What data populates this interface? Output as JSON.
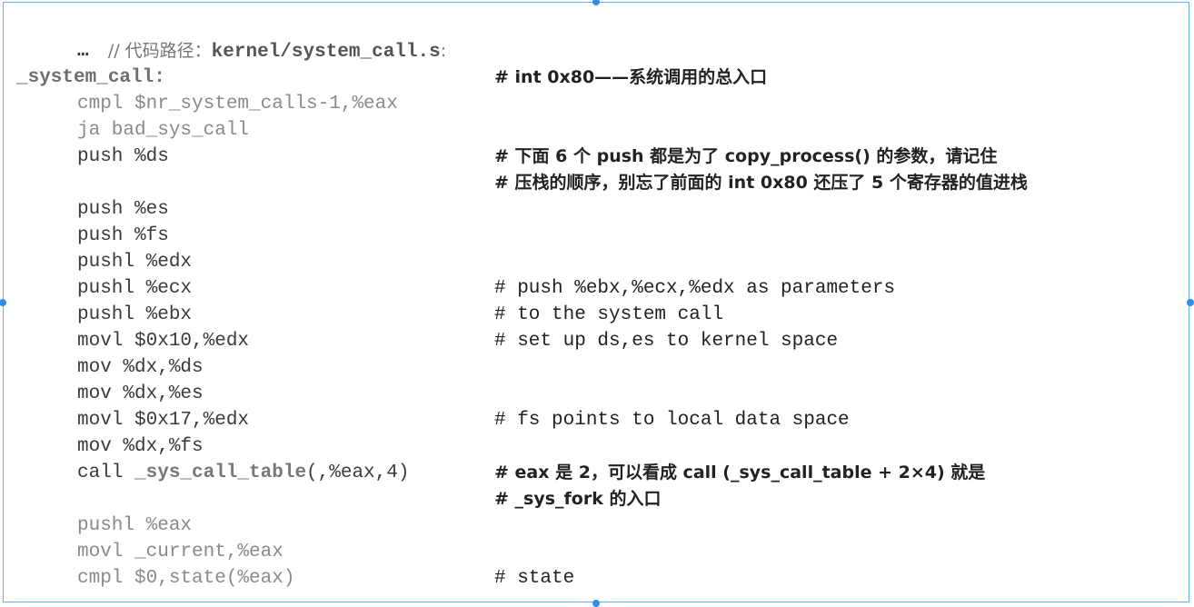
{
  "header": {
    "comment_prefix": "// 代码路径：",
    "path": "kernel/system_call.s",
    "colon": ":"
  },
  "ellipsis": "…",
  "lines": [
    {
      "code": "_system_call:",
      "comment": "# int 0x80——系统调用的总入口"
    },
    {
      "code": "cmpl $nr_system_calls-1,%eax",
      "comment": ""
    },
    {
      "code": "ja bad_sys_call",
      "comment": ""
    },
    {
      "code": "push %ds",
      "comment": "# 下面 6 个 push 都是为了 copy_process() 的参数，请记住"
    },
    {
      "code": "",
      "comment": "# 压栈的顺序，别忘了前面的 int 0x80 还压了 5 个寄存器的值进栈"
    },
    {
      "code": "push %es",
      "comment": ""
    },
    {
      "code": "push %fs",
      "comment": ""
    },
    {
      "code": "pushl %edx",
      "comment": ""
    },
    {
      "code": "pushl %ecx",
      "comment": "# push %ebx,%ecx,%edx as parameters"
    },
    {
      "code": "pushl %ebx",
      "comment": "# to the system call"
    },
    {
      "code": "movl $0x10,%edx",
      "comment": "# set up ds,es to kernel space"
    },
    {
      "code": "mov %dx,%ds",
      "comment": ""
    },
    {
      "code": "mov %dx,%es",
      "comment": ""
    },
    {
      "code": "movl $0x17,%edx",
      "comment": "# fs points to local data space"
    },
    {
      "code": "mov %dx,%fs",
      "comment": ""
    },
    {
      "code_prefix": "call ",
      "code_bold": "_sys_call_table",
      "code_suffix": "(,%eax,4)",
      "comment": "# eax 是 2，可以看成 call (_sys_call_table + 2×4) 就是"
    },
    {
      "code": "",
      "comment": "# _sys_fork 的入口"
    },
    {
      "code": "pushl %eax",
      "comment": ""
    },
    {
      "code": "movl _current,%eax",
      "comment": ""
    },
    {
      "code": "cmpl $0,state(%eax)",
      "comment": "# state"
    }
  ]
}
